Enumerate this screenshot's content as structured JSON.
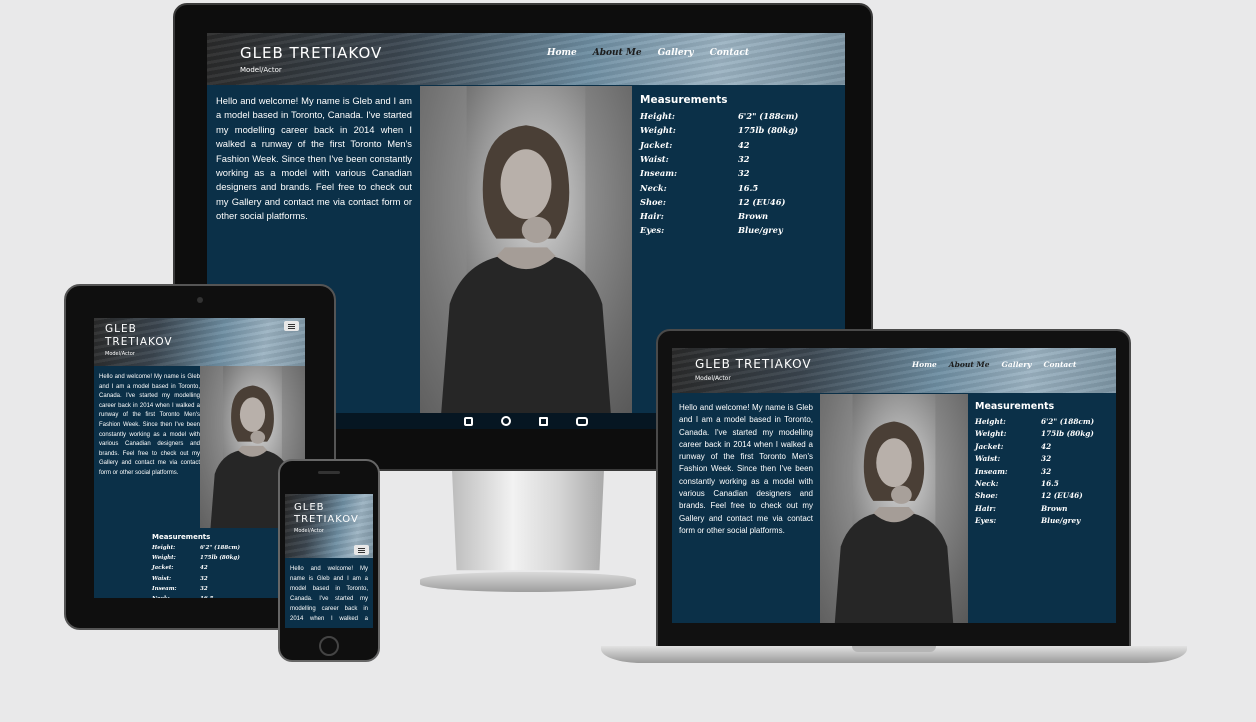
{
  "site": {
    "brand": "GLEB TRETIAKOV",
    "brand_line1": "GLEB",
    "brand_line2": "TRETIAKOV",
    "subtitle": "Model/Actor",
    "nav": [
      "Home",
      "About Me",
      "Gallery",
      "Contact"
    ],
    "about_text": "Hello and welcome! My name is Gleb and I am a model based in Toronto, Canada. I've started my modelling career back in 2014 when I walked a runway of the first Toronto Men's Fashion Week. Since then I've been constantly working as a model with various Canadian designers and brands. Feel free to check out my Gallery and contact me via contact form or other social platforms.",
    "measurements_title": "Measurements",
    "measurements": [
      {
        "label": "Height:",
        "value": "6'2\" (188cm)"
      },
      {
        "label": "Weight:",
        "value": "175lb (80kg)"
      },
      {
        "label": "Jacket:",
        "value": "42"
      },
      {
        "label": "Waist:",
        "value": "32"
      },
      {
        "label": "Inseam:",
        "value": "32"
      },
      {
        "label": "Neck:",
        "value": "16.5"
      },
      {
        "label": "Shoe:",
        "value": "12 (EU46)"
      },
      {
        "label": "Hair:",
        "value": "Brown"
      },
      {
        "label": "Eyes:",
        "value": "Blue/grey"
      }
    ],
    "social_icons": [
      "instagram-icon",
      "facebook-icon",
      "linkedin-icon",
      "youtube-icon"
    ]
  },
  "colors": {
    "background": "#e9e9ea",
    "site_bg": "#0b3048",
    "footer_bg": "#061622",
    "device_frame": "#111111"
  }
}
